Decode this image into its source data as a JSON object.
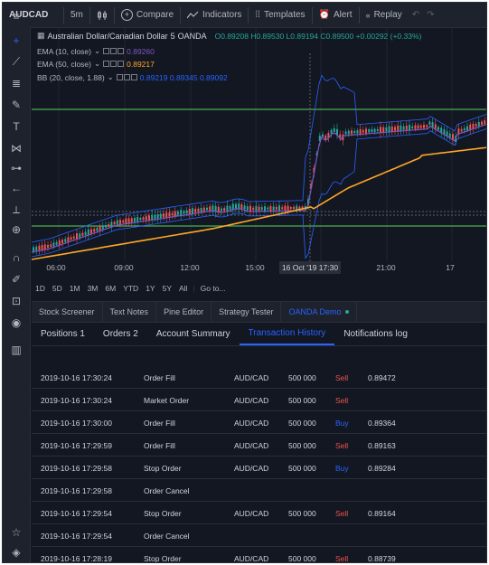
{
  "toolbar": {
    "symbol": "AUDCAD",
    "interval": "5m",
    "compare": "Compare",
    "indicators": "Indicators",
    "templates": "Templates",
    "alert": "Alert",
    "replay": "Replay"
  },
  "legend": {
    "main": "Australian Dollar/Canadian Dollar",
    "res": "5",
    "exchange": "OANDA",
    "ohlc": "O0.89208 H0.89530 L0.89194 C0.89500 +0.00292 (+0.33%)",
    "ema10_label": "EMA (10, close)",
    "ema10_value": "0.89260",
    "ema50_label": "EMA (50, close)",
    "ema50_value": "0.89217",
    "bb_label": "BB (20, close, 1.88)",
    "bb_values": "0.89219  0.89345  0.89092"
  },
  "time_axis": {
    "labels": [
      "06:00",
      "09:00",
      "12:00",
      "15:00",
      "21:00",
      "17"
    ],
    "highlight": "16 Oct '19   17:30"
  },
  "ranges": [
    "1D",
    "5D",
    "1M",
    "3M",
    "6M",
    "YTD",
    "1Y",
    "5Y",
    "All",
    "Go to..."
  ],
  "bottom_tabs": [
    "Stock Screener",
    "Text Notes",
    "Pine Editor",
    "Strategy Tester",
    "OANDA Demo"
  ],
  "subtabs": [
    "Positions  1",
    "Orders  2",
    "Account Summary",
    "Transaction History",
    "Notifications log"
  ],
  "transactions": [
    {
      "time": "2019-10-16 17:30:24",
      "type": "Order Fill",
      "symbol": "AUD/CAD",
      "qty": "500 000",
      "side": "Sell",
      "price": "0.89472"
    },
    {
      "time": "2019-10-16 17:30:24",
      "type": "Market Order",
      "symbol": "AUD/CAD",
      "qty": "500 000",
      "side": "Sell",
      "price": ""
    },
    {
      "time": "2019-10-16 17:30:00",
      "type": "Order Fill",
      "symbol": "AUD/CAD",
      "qty": "500 000",
      "side": "Buy",
      "price": "0.89364"
    },
    {
      "time": "2019-10-16 17:29:59",
      "type": "Order Fill",
      "symbol": "AUD/CAD",
      "qty": "500 000",
      "side": "Sell",
      "price": "0.89163"
    },
    {
      "time": "2019-10-16 17:29:58",
      "type": "Stop Order",
      "symbol": "AUD/CAD",
      "qty": "500 000",
      "side": "Buy",
      "price": "0.89284"
    },
    {
      "time": "2019-10-16 17:29:58",
      "type": "Order Cancel",
      "symbol": "",
      "qty": "",
      "side": "",
      "price": ""
    },
    {
      "time": "2019-10-16 17:29:54",
      "type": "Stop Order",
      "symbol": "AUD/CAD",
      "qty": "500 000",
      "side": "Sell",
      "price": "0.89164"
    },
    {
      "time": "2019-10-16 17:29:54",
      "type": "Order Cancel",
      "symbol": "",
      "qty": "",
      "side": "",
      "price": ""
    },
    {
      "time": "2019-10-16 17:28:19",
      "type": "Stop Order",
      "symbol": "AUD/CAD",
      "qty": "500 000",
      "side": "Sell",
      "price": "0.88739"
    }
  ],
  "colors": {
    "background": "#131722",
    "panel": "#1e222d",
    "accent": "#2962ff",
    "sell": "#ef5350",
    "buy": "#2962ff",
    "ema10": "#7e57c2",
    "ema50": "#ffa726",
    "bb": "#2962ff",
    "level_lines": "#4caf50",
    "candle_up": "#26a69a",
    "candle_down": "#ef5350"
  }
}
